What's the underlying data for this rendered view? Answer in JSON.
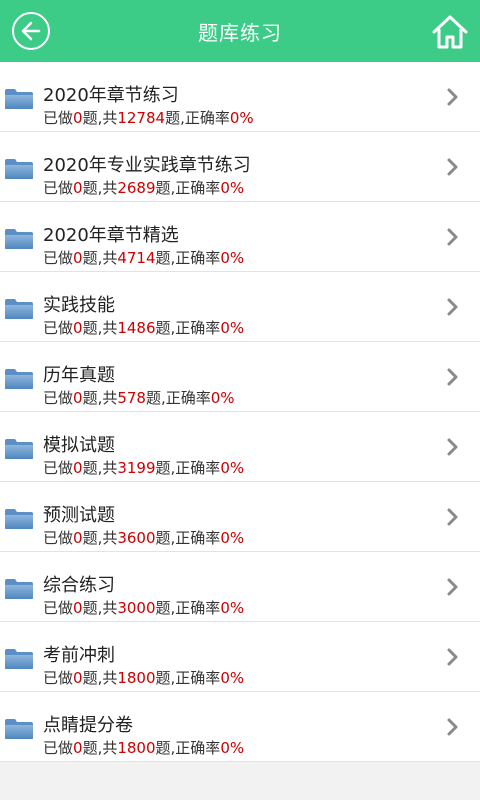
{
  "header": {
    "title": "题库练习",
    "back_icon": "back-arrow-icon",
    "home_icon": "home-icon",
    "bg_color": "#3dcc88"
  },
  "labels": {
    "done_prefix": "已做",
    "done_suffix": "题,共",
    "total_suffix": "题,正确率",
    "highlight_color": "#cc0000"
  },
  "items": [
    {
      "title": "2020年章节练习",
      "done": "0",
      "total": "12784",
      "accuracy": "0%"
    },
    {
      "title": "2020年专业实践章节练习",
      "done": "0",
      "total": "2689",
      "accuracy": "0%"
    },
    {
      "title": "2020年章节精选",
      "done": "0",
      "total": "4714",
      "accuracy": "0%"
    },
    {
      "title": "实践技能",
      "done": "0",
      "total": "1486",
      "accuracy": "0%"
    },
    {
      "title": "历年真题",
      "done": "0",
      "total": "578",
      "accuracy": "0%"
    },
    {
      "title": "模拟试题",
      "done": "0",
      "total": "3199",
      "accuracy": "0%"
    },
    {
      "title": "预测试题",
      "done": "0",
      "total": "3600",
      "accuracy": "0%"
    },
    {
      "title": "综合练习",
      "done": "0",
      "total": "3000",
      "accuracy": "0%"
    },
    {
      "title": "考前冲刺",
      "done": "0",
      "total": "1800",
      "accuracy": "0%"
    },
    {
      "title": "点睛提分卷",
      "done": "0",
      "total": "1800",
      "accuracy": "0%"
    }
  ]
}
